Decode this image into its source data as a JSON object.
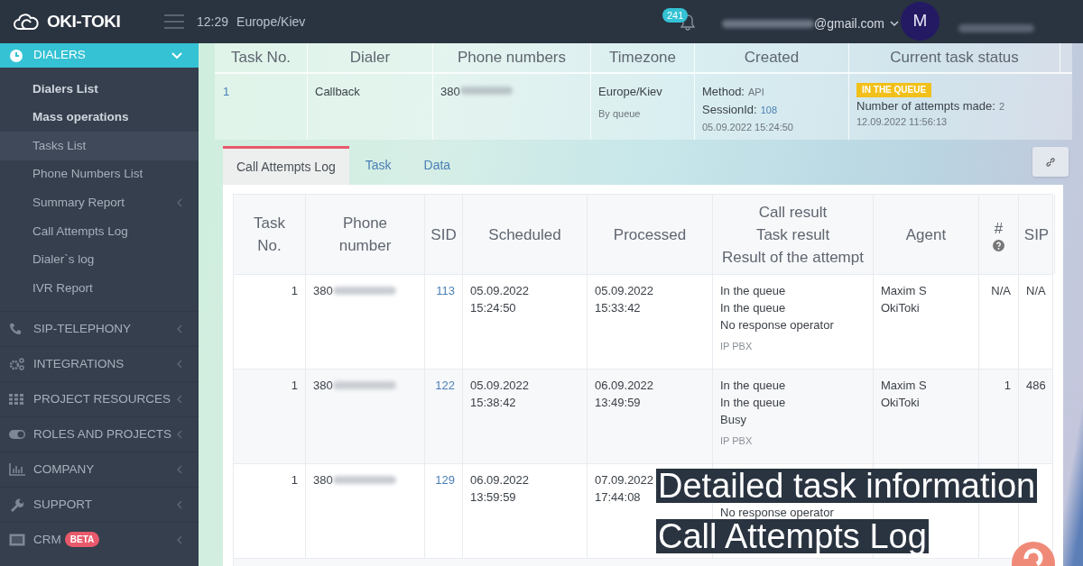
{
  "topbar": {
    "logo": "OKI-TOKI",
    "time": "12:29",
    "timezone": "Europe/Kiev",
    "notifications": "241",
    "email": "@gmail.com",
    "avatar": "M"
  },
  "sidebar": {
    "items": [
      {
        "kind": "section",
        "label": "DIALERS",
        "expanded": true,
        "children": [
          {
            "label": "Dialers List",
            "bold": true,
            "selected": false,
            "has_arrow": false
          },
          {
            "label": "Mass operations",
            "bold": true,
            "selected": false,
            "has_arrow": false
          },
          {
            "label": "Tasks List",
            "bold": false,
            "selected": true,
            "has_arrow": false
          },
          {
            "label": "Phone Numbers List",
            "bold": false,
            "selected": false,
            "has_arrow": false
          },
          {
            "label": "Summary Report",
            "bold": false,
            "selected": false,
            "has_arrow": true
          },
          {
            "label": "Call Attempts Log",
            "bold": false,
            "selected": false,
            "has_arrow": false
          },
          {
            "label": "Dialer`s log",
            "bold": false,
            "selected": false,
            "has_arrow": false
          },
          {
            "label": "IVR Report",
            "bold": false,
            "selected": false,
            "has_arrow": false
          }
        ]
      },
      {
        "kind": "section",
        "label": "SIP-TELEPHONY",
        "expanded": false
      },
      {
        "kind": "section",
        "label": "INTEGRATIONS",
        "expanded": false
      },
      {
        "kind": "section",
        "label": "PROJECT RESOURCES",
        "expanded": false
      },
      {
        "kind": "section",
        "label": "ROLES AND PROJECTS",
        "expanded": false
      },
      {
        "kind": "section",
        "label": "COMPANY",
        "expanded": false
      },
      {
        "kind": "section",
        "label": "SUPPORT",
        "expanded": false
      },
      {
        "kind": "section",
        "label": "CRM",
        "expanded": false,
        "badge": "BETA"
      }
    ]
  },
  "task_info": {
    "columns": [
      "Task No.",
      "Dialer",
      "Phone numbers",
      "Timezone",
      "Created",
      "Current task status"
    ],
    "row": {
      "task_no": "1",
      "dialer": "Callback",
      "phone": "380",
      "timezone": "Europe/Kiev",
      "timezone_mode": "By queue",
      "method_label": "Method:",
      "method": "API",
      "session_label": "SessionId:",
      "session": "108",
      "created": "05.09.2022 15:24:50",
      "status": "IN THE QUEUE",
      "attempts_label": "Number of attempts made:",
      "attempts": "2",
      "updated": "12.09.2022 11:56:13"
    }
  },
  "tabs": [
    {
      "label": "Call Attempts Log",
      "selected": true
    },
    {
      "label": "Task",
      "selected": false
    },
    {
      "label": "Data",
      "selected": false
    }
  ],
  "attempts": {
    "columns": [
      {
        "lines": [
          "Task",
          "No."
        ]
      },
      {
        "lines": [
          "Phone",
          "number"
        ]
      },
      {
        "lines": [
          "SID"
        ]
      },
      {
        "lines": [
          "Scheduled"
        ]
      },
      {
        "lines": [
          "Processed"
        ]
      },
      {
        "lines": [
          "Call result",
          "Task result",
          "Result of the attempt"
        ]
      },
      {
        "lines": [
          "Agent"
        ]
      },
      {
        "lines": [
          "#"
        ],
        "help": true
      },
      {
        "lines": [
          "SIP"
        ]
      }
    ],
    "rows": [
      {
        "task_no": "1",
        "phone": "380",
        "sid": "113",
        "scheduled": [
          "05.09.2022",
          "15:24:50"
        ],
        "processed": [
          "05.09.2022",
          "15:33:42"
        ],
        "result": [
          "In the queue",
          "In the queue",
          "No response operator"
        ],
        "source": "IP PBX",
        "agent": [
          "Maxim S",
          "OkiToki"
        ],
        "attempt": "N/A",
        "sip": "N/A"
      },
      {
        "task_no": "1",
        "phone": "380",
        "sid": "122",
        "scheduled": [
          "05.09.2022",
          "15:38:42"
        ],
        "processed": [
          "06.09.2022",
          "13:49:59"
        ],
        "result": [
          "In the queue",
          "In the queue",
          "Busy"
        ],
        "source": "IP PBX",
        "agent": [
          "Maxim S",
          "OkiToki"
        ],
        "attempt": "1",
        "sip": "486"
      },
      {
        "task_no": "1",
        "phone": "380",
        "sid": "129",
        "scheduled": [
          "06.09.2022",
          "13:59:59"
        ],
        "processed": [
          "07.09.2022",
          "17:44:08"
        ],
        "result_below_caption": [
          "No response operator"
        ]
      }
    ]
  },
  "caption": [
    "Detailed task information",
    "Call Attempts Log"
  ]
}
